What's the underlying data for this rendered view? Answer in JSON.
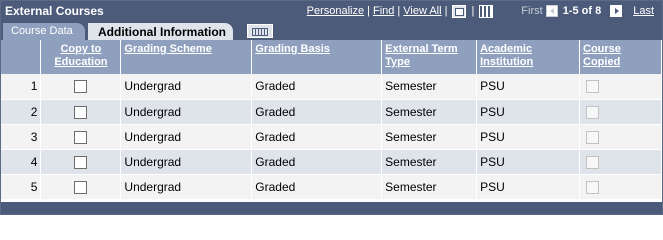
{
  "header": {
    "title": "External Courses",
    "personalize": "Personalize",
    "find": "Find",
    "view_all": "View All",
    "first": "First",
    "count": "1-5 of 8",
    "last": "Last",
    "icons": [
      "zoom-icon",
      "download-icon",
      "prev-arrow-icon",
      "next-arrow-icon"
    ]
  },
  "tabs": {
    "course_data": "Course Data",
    "additional_info": "Additional Information",
    "show_all_icon": "show-all-columns-icon"
  },
  "columns": {
    "copy": "Copy to Education",
    "scheme": "Grading Scheme",
    "basis": "Grading Basis",
    "term": "External Term Type",
    "inst": "Academic Institution",
    "copied": "Course Copied"
  },
  "rows": [
    {
      "num": "1",
      "scheme": "Undergrad",
      "basis": "Graded",
      "term": "Semester",
      "inst": "PSU"
    },
    {
      "num": "2",
      "scheme": "Undergrad",
      "basis": "Graded",
      "term": "Semester",
      "inst": "PSU"
    },
    {
      "num": "3",
      "scheme": "Undergrad",
      "basis": "Graded",
      "term": "Semester",
      "inst": "PSU"
    },
    {
      "num": "4",
      "scheme": "Undergrad",
      "basis": "Graded",
      "term": "Semester",
      "inst": "PSU"
    },
    {
      "num": "5",
      "scheme": "Undergrad",
      "basis": "Graded",
      "term": "Semester",
      "inst": "PSU"
    }
  ],
  "colors": {
    "header_bg": "#4c5b7a",
    "column_header_bg": "#8fa0bf",
    "row_odd": "#f3f3f3",
    "row_even": "#dfe3ea"
  }
}
